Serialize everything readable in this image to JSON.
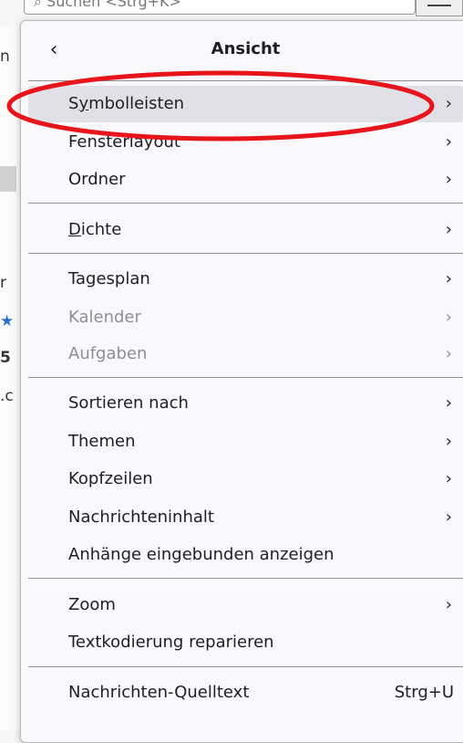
{
  "background": {
    "search_placeholder": "⌕ Suchen <Strg+K>",
    "fragments": [
      "n",
      "r",
      "5",
      ".c"
    ]
  },
  "menu": {
    "title": "Ansicht",
    "back_glyph": "‹",
    "chevron_glyph": "›",
    "items": [
      {
        "label": "Symbolleisten",
        "mnemonic": "y",
        "submenu": true,
        "disabled": false,
        "hover": true
      },
      {
        "label": "Fensterlayout",
        "submenu": true,
        "disabled": false
      },
      {
        "label": "Ordner",
        "submenu": true,
        "disabled": false
      },
      {
        "label": "Dichte",
        "mnemonic": "D",
        "submenu": true,
        "disabled": false
      },
      {
        "label": "Tagesplan",
        "submenu": true,
        "disabled": false
      },
      {
        "label": "Kalender",
        "submenu": true,
        "disabled": true
      },
      {
        "label": "Aufgaben",
        "submenu": true,
        "disabled": true
      },
      {
        "label": "Sortieren nach",
        "submenu": true,
        "disabled": false
      },
      {
        "label": "Themen",
        "submenu": true,
        "disabled": false
      },
      {
        "label": "Kopfzeilen",
        "submenu": true,
        "disabled": false
      },
      {
        "label": "Nachrichteninhalt",
        "submenu": true,
        "disabled": false
      },
      {
        "label": "Anhänge eingebunden anzeigen",
        "submenu": false,
        "disabled": false
      },
      {
        "label": "Zoom",
        "submenu": true,
        "disabled": false
      },
      {
        "label": "Textkodierung reparieren",
        "submenu": false,
        "disabled": false
      },
      {
        "label": "Nachrichten-Quelltext",
        "shortcut": "Strg+U",
        "submenu": false,
        "disabled": false
      }
    ]
  },
  "annotation": {
    "color": "#e8141c",
    "shape": "ellipse",
    "target": "Symbolleisten"
  },
  "colors": {
    "hover": "#e0e0e6",
    "disabled": "#8e8e93",
    "accent_star": "#2a6fd6"
  }
}
